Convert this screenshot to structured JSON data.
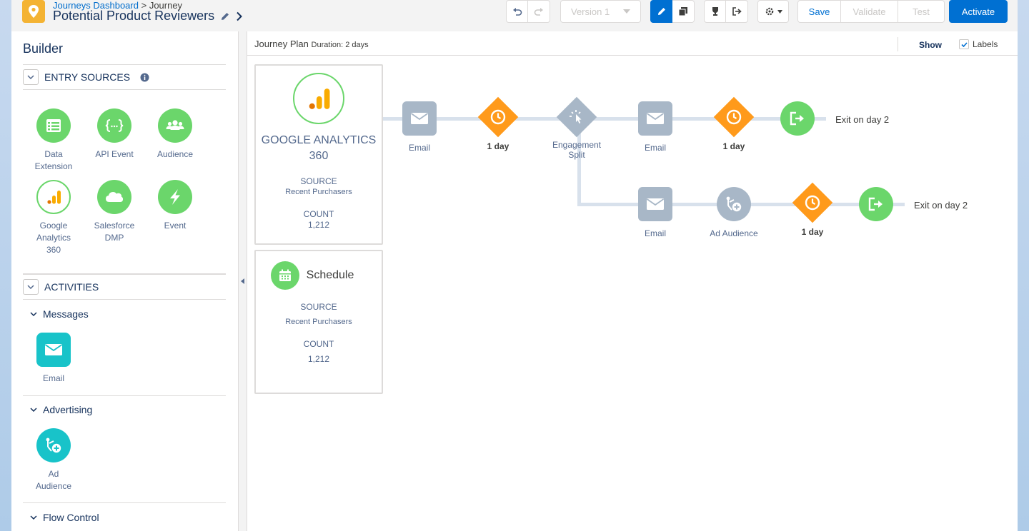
{
  "header": {
    "breadcrumb_link": "Journeys Dashboard",
    "breadcrumb_sep": ">",
    "breadcrumb_current": "Journey",
    "title": "Potential Product Reviewers",
    "version_label": "Version 1",
    "save_label": "Save",
    "validate_label": "Validate",
    "test_label": "Test",
    "activate_label": "Activate"
  },
  "sidebar": {
    "title": "Builder",
    "entry_sources": {
      "heading": "ENTRY SOURCES",
      "items": [
        {
          "label": "Data Extension",
          "icon": "table-icon"
        },
        {
          "label": "API Event",
          "icon": "code-braces-icon"
        },
        {
          "label": "Audience",
          "icon": "people-icon"
        },
        {
          "label": "Google Analytics 360",
          "icon": "analytics-bars-icon"
        },
        {
          "label": "Salesforce DMP",
          "icon": "cloud-icon"
        },
        {
          "label": "Event",
          "icon": "lightning-icon"
        }
      ]
    },
    "activities": {
      "heading": "ACTIVITIES",
      "messages": {
        "heading": "Messages",
        "items": [
          {
            "label": "Email",
            "icon": "envelope-icon"
          }
        ]
      },
      "advertising": {
        "heading": "Advertising",
        "items": [
          {
            "label": "Ad Audience",
            "icon": "ad-audience-icon"
          }
        ]
      },
      "flow_control": {
        "heading": "Flow Control"
      }
    }
  },
  "canvas": {
    "plan_title": "Journey Plan",
    "duration": "Duration: 2 days",
    "show_label": "Show",
    "labels_toggle": "Labels",
    "labels_checked": true,
    "sources": [
      {
        "name_line1": "GOOGLE ANALYTICS",
        "name_line2": "360",
        "source_label": "SOURCE",
        "source_value": "Recent Purchasers",
        "count_label": "COUNT",
        "count_value": "1,212"
      },
      {
        "name": "Schedule",
        "source_label": "SOURCE",
        "source_value": "Recent Purchasers",
        "count_label": "COUNT",
        "count_value": "1,212"
      }
    ],
    "path_top": [
      {
        "label": "Email",
        "type": "email"
      },
      {
        "label": "1 day",
        "type": "wait"
      },
      {
        "label": "Engagement Split",
        "type": "split"
      },
      {
        "label": "Email",
        "type": "email"
      },
      {
        "label": "1 day",
        "type": "wait"
      },
      {
        "label": "Exit on day 2",
        "type": "exit"
      }
    ],
    "path_bottom": [
      {
        "label": "Email",
        "type": "email"
      },
      {
        "label": "Ad Audience",
        "type": "ad-audience"
      },
      {
        "label": "1 day",
        "type": "wait"
      },
      {
        "label": "Exit on day 2",
        "type": "exit"
      }
    ]
  },
  "colors": {
    "brand": "#0070d2",
    "green": "#6bd66b",
    "orange": "#ff9a1b",
    "gray_node": "#a8b7c7",
    "teal": "#18c3c9"
  }
}
